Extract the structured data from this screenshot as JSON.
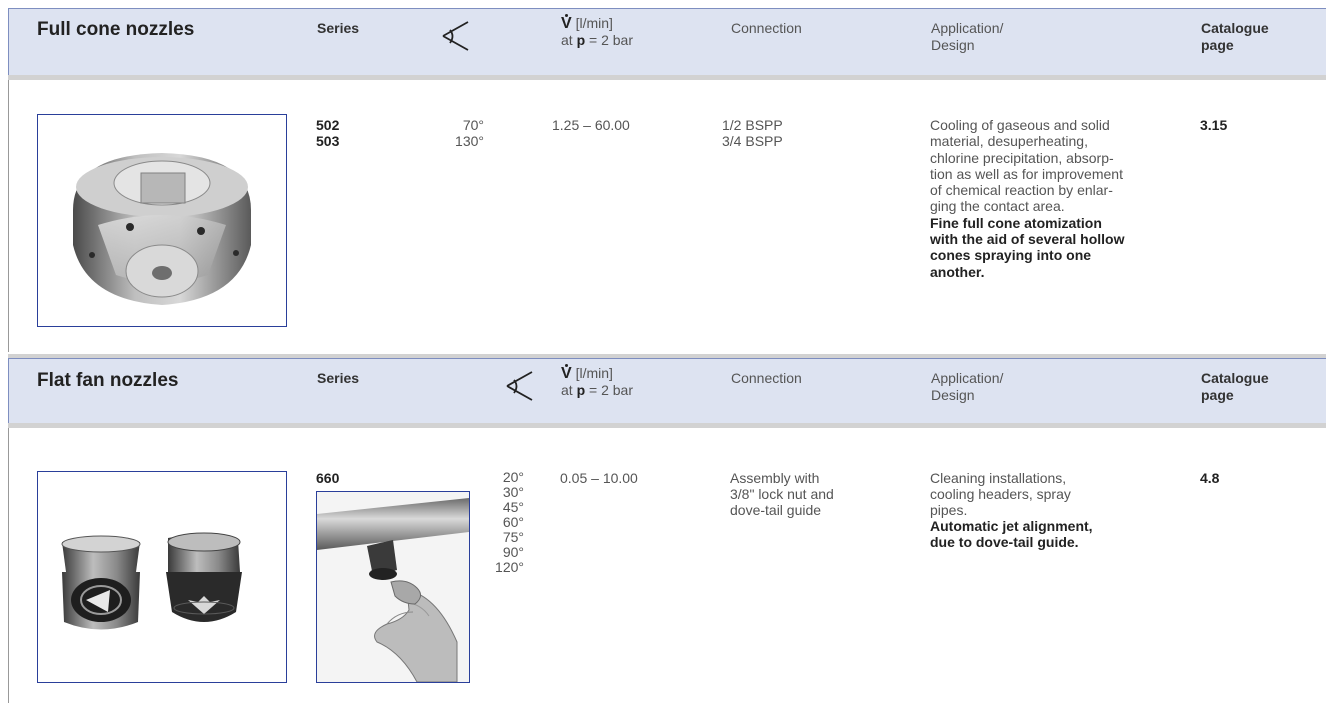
{
  "sections": [
    {
      "title": "Full cone nozzles",
      "header": {
        "series": "Series",
        "flow_symbol": "V",
        "flow_unit": "[l/min]",
        "flow_at": "at",
        "flow_p": "p",
        "flow_eq": "= 2 bar",
        "connection": "Connection",
        "application_1": "Application/",
        "application_2": "Design",
        "catalogue_1": "Catalogue",
        "catalogue_2": "page"
      },
      "row": {
        "series": [
          "502",
          "503"
        ],
        "angles": [
          "70°",
          "130°"
        ],
        "flow": "1.25 – 60.00",
        "connection": [
          "1/2 BSPP",
          "3/4 BSPP"
        ],
        "application": [
          "Cooling of gaseous and solid",
          "material, desuperheating,",
          "chlorine precipitation, absorp-",
          "tion as well as for improvement",
          "of chemical reaction by enlar-",
          "ging the contact area."
        ],
        "design": [
          "Fine full cone atomization",
          "with the aid of several hollow",
          "cones spraying into one",
          "another."
        ],
        "catalogue_page": "3.15"
      }
    },
    {
      "title": "Flat fan nozzles",
      "header": {
        "series": "Series",
        "flow_symbol": "V",
        "flow_unit": "[l/min]",
        "flow_at": "at",
        "flow_p": "p",
        "flow_eq": "= 2 bar",
        "connection": "Connection",
        "application_1": "Application/",
        "application_2": "Design",
        "catalogue_1": "Catalogue",
        "catalogue_2": "page"
      },
      "row": {
        "series": [
          "660"
        ],
        "angles": [
          "20°",
          "30°",
          "45°",
          "60°",
          "75°",
          "90°",
          "120°"
        ],
        "flow": "0.05 – 10.00",
        "connection": [
          "Assembly with",
          "3/8\" lock nut and",
          "dove-tail guide"
        ],
        "application": [
          "Cleaning installations,",
          "cooling headers, spray",
          "pipes."
        ],
        "design": [
          "Automatic jet alignment,",
          "due to dove-tail guide."
        ],
        "catalogue_page": "4.8"
      }
    }
  ],
  "colors": {
    "header_bg": "#dde3f1",
    "header_border": "#7e8ec0",
    "photo_border": "#2a3f9a"
  }
}
